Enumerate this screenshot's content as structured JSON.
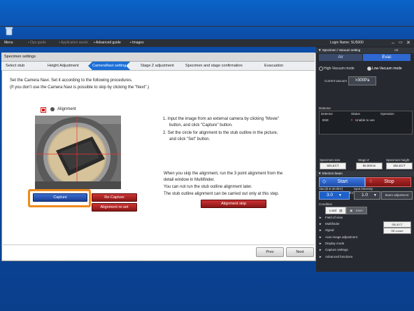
{
  "toolbar": {
    "menu": "Menu",
    "ops_guide": "Ops guide",
    "application_assist": "Application assist",
    "advanced_guide": "Advanced guide",
    "images": "Images",
    "login_label": "Login Name:",
    "login_name": "SU5000"
  },
  "window": {
    "title": "Specimen settings",
    "steps": [
      "Select stub",
      "Height Adjustment",
      "CameraNavi setting",
      "Stage Z adjustment",
      "Specimen and stage confirmation",
      "Evacuation"
    ],
    "active_step": "CameraNavi setting",
    "intro_line1": "Set the Camera Navi. Set it according to the following procedures.",
    "intro_line2": "(If you don't use the Camera Navi is possible to skip by clicking the \"Next\".)",
    "alignment_label": "Alignment",
    "instruction1a": "1. Input the image from an external camera by clicking \"Movie\"",
    "instruction1b": "button, and click \"Capture\" button.",
    "instruction2a": "2. Set the circle for alignment to the stub outline in the picture,",
    "instruction2b": "and click \"Set\" button.",
    "skip_text1": "When you skip the alignment, run the 3 point alignment from the",
    "skip_text2": "detail window in Multifinder.",
    "skip_text3": "You can not run the stub outline alignment later.",
    "skip_text4": "The stub outline alignment can be carried out only at this step.",
    "capture": "Capture",
    "recapture": "Re-Capture",
    "alignment_reset": "Alignment re-set",
    "alignment_skip": "Alignment skip",
    "prev": "Prev",
    "next": "Next"
  },
  "panel": {
    "vacuum_title": "Specimen / Vacuum setting",
    "air_tab": "Air",
    "air": "Air",
    "evac": "Evac",
    "high_vac": "High-Vacuum mode",
    "low_vac": "Low-Vacuum mode",
    "current_vacuum_label": "Current vacuum",
    "current_vacuum": ">300Pa",
    "detector_title": "Detector",
    "det_col1": "Detector",
    "det_col2": "Status",
    "det_col3": "Operation",
    "det_name": "BSE",
    "det_status": "Unable to use",
    "specimen_size_label": "Specimen size",
    "specimen_size": "SELECT",
    "stage_z_label": "Stage Z",
    "stage_z": "65.00mm",
    "specimen_height_label": "Specimen height",
    "specimen_height": "SELECT",
    "electron_beam": "Electron beam",
    "start": "Start",
    "stop": "Stop",
    "vacc_label": "Vacc[0.5-30.0kV]",
    "vacc_value": "3.0",
    "spot_label": "Spot intensity",
    "spot_value": "1.0",
    "beam_adjust": "Beam adjustment",
    "condition_label": "Condition",
    "load": "Load",
    "save": "Save",
    "field_of_view": "Field of view",
    "multifinder": "Multifinder",
    "multifinder_btn": "SELECT",
    "signal": "Signal",
    "signal_btn": "SE-Lower",
    "auto_image": "Auto image adjustment",
    "display_mode": "Display mode",
    "capture_settings": "Capture settings",
    "advanced_functions": "Advanced functions"
  }
}
